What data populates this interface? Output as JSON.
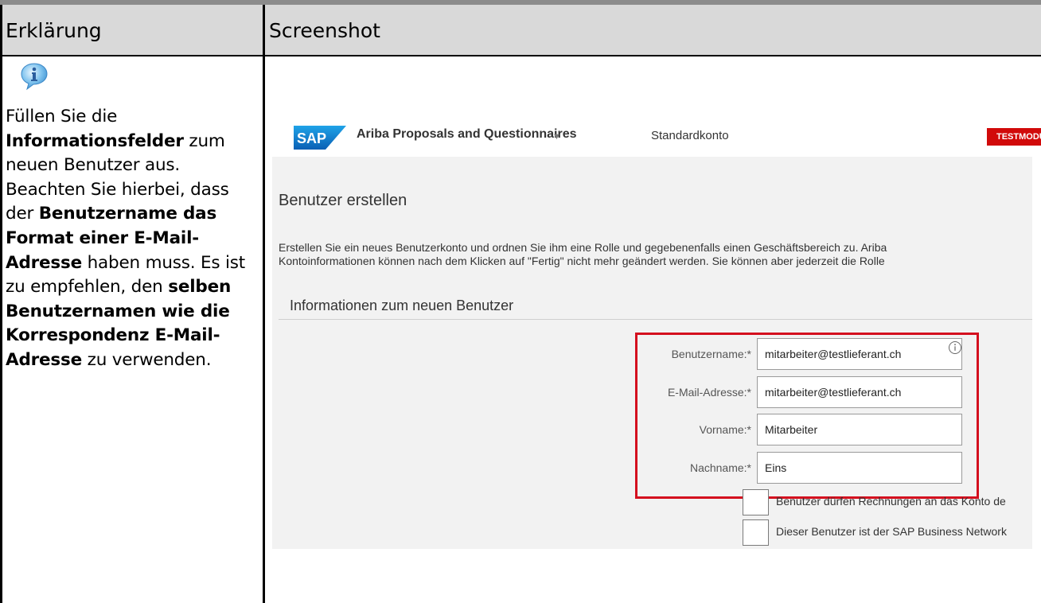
{
  "table": {
    "header_left": "Erklärung",
    "header_right": "Screenshot"
  },
  "explanation": {
    "icon": "info-icon",
    "parts": [
      {
        "text": "Füllen Sie die ",
        "highlight": false
      },
      {
        "text": "Informationsfelder",
        "highlight": true
      },
      {
        "text": " zum neuen Benutzer aus. Beachten Sie hierbei, dass der ",
        "highlight": false
      },
      {
        "text": "Benutzername das Format einer E-Mail-Adresse",
        "highlight": true
      },
      {
        "text": " haben muss. Es ist zu empfehlen, den ",
        "highlight": false
      },
      {
        "text": "selben Benutzernamen wie die Korrespondenz E-Mail-Adresse",
        "highlight": true
      },
      {
        "text": " zu verwenden.",
        "highlight": false
      }
    ]
  },
  "screenshot": {
    "logo_text": "SAP",
    "app_name": "Ariba Proposals and Questionnaires",
    "account": "Standardkonto",
    "badge": "TESTMODUS",
    "page_title": "Benutzer erstellen",
    "description_line1": "Erstellen Sie ein neues Benutzerkonto und ordnen Sie ihm eine Rolle und gegebenenfalls einen Geschäftsbereich zu. Ariba",
    "description_line2": "Kontoinformationen können nach dem Klicken auf \"Fertig\" nicht mehr geändert werden. Sie können aber jederzeit die Rolle",
    "section_title": "Informationen zum neuen Benutzer",
    "fields": [
      {
        "label": "Benutzername:*",
        "value": "mitarbeiter@testlieferant.ch"
      },
      {
        "label": "E-Mail-Adresse:*",
        "value": "mitarbeiter@testlieferant.ch"
      },
      {
        "label": "Vorname:*",
        "value": "Mitarbeiter"
      },
      {
        "label": "Nachname:*",
        "value": "Eins"
      }
    ],
    "checkboxes": [
      {
        "label": "Benutzer dürfen Rechnungen an das Konto de"
      },
      {
        "label": "Dieser Benutzer ist der SAP Business Network"
      }
    ],
    "colors": {
      "highlight_frame": "#d40f1e",
      "badge": "#d10a0a",
      "sap_blue": "#0a6ed1"
    }
  }
}
